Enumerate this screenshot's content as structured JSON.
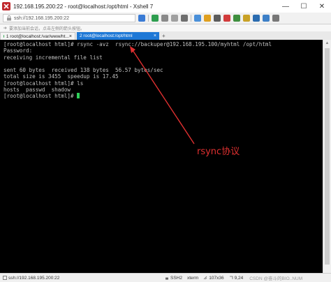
{
  "window": {
    "title": "192.168.195.200:22 - root@localhost:/opt/html - Xshell 7",
    "min_symbol": "—",
    "max_symbol": "☐",
    "close_symbol": "✕"
  },
  "toolbar": {
    "address": "ssh://192.168.195.200:22"
  },
  "hint": {
    "text": "要添加当前会话，点击左侧的箭头按钮。"
  },
  "tabs": [
    {
      "label": "1 root@localhost:/var/www/ht...",
      "close": "×",
      "active": false
    },
    {
      "label": "2 root@localhost:/opt/html",
      "close": "×",
      "active": true
    }
  ],
  "tab_add": "+",
  "terminal": {
    "lines": [
      "[root@localhost html]# rsync -avz  rsync://backuper@192.168.195.100/myhtml /opt/html",
      "Password:",
      "receiving incremental file list",
      "",
      "sent 60 bytes  received 138 bytes  56.57 bytes/sec",
      "total size is 3455  speedup is 17.45",
      "[root@localhost html]# ls",
      "hosts  passwd  shadow"
    ],
    "prompt": "[root@localhost html]# "
  },
  "annotation": {
    "label": "rsync协议",
    "color": "#e03030"
  },
  "status": {
    "host": "ssh://192.168.195.200:22",
    "protocol": "SSH2",
    "term": "xterm",
    "size": "107x36",
    "position": "9,24",
    "watermark": "CSDN @奋斗的BIO..NUM"
  },
  "colors": {
    "tab_active": "#1e78d6",
    "terminal_bg": "#000000",
    "terminal_text": "#c0c0c0",
    "cursor": "#2fd05a"
  }
}
